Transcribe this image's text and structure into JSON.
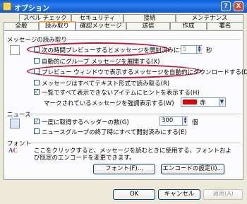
{
  "window": {
    "title": "オプション",
    "help": "?",
    "close": "X"
  },
  "tabs_back": [
    "スペル チェック",
    "セキュリティ",
    "接続",
    "メンテナンス"
  ],
  "tabs_front": [
    "全般",
    "読み取り",
    "確認メッセージ",
    "送信",
    "作成",
    "署名"
  ],
  "sections": {
    "reading": {
      "title": "メッセージの読み取り",
      "preview_mark_read": "次の時間プレビューするとメッセージを開封済みにする(M)",
      "seconds_value": "5",
      "seconds_unit": "秒",
      "auto_expand": "自動的にグループ メッセージを展開する(X)",
      "auto_download": "プレビュー ウィンドウで表示するメッセージを自動的にダウンロードする(D)",
      "plain_text": "メッセージはすべてテキスト形式で読み取る(R)",
      "show_tooltips": "一覧ですべて表示できないアイテムにヒントを表示する(H)",
      "highlight_label": "マークされているメッセージを強調表示する(W)",
      "highlight_color": "赤"
    },
    "news": {
      "title": "ニュース",
      "headers_label": "一度に取得するヘッダーの数(G)",
      "headers_value": "300",
      "headers_unit": "個",
      "mark_all_read": "ニュースグループの終了時にすべて開封済みにする(E)"
    },
    "fonts": {
      "title": "フォント",
      "desc1": "ここをクリックすると、メッセージを読むときに使用する、フォントおよ",
      "desc2": "び既定のエンコードを変更できます。",
      "font_button": "フォント(F)...",
      "encoding_button": "エンコードの設定(I)..."
    }
  },
  "footer": {
    "ok": "OK",
    "cancel": "キャンセル",
    "apply": "適用(A)"
  },
  "colors": {
    "accent_oval": "#c8102e",
    "highlight_red": "#e00000"
  }
}
